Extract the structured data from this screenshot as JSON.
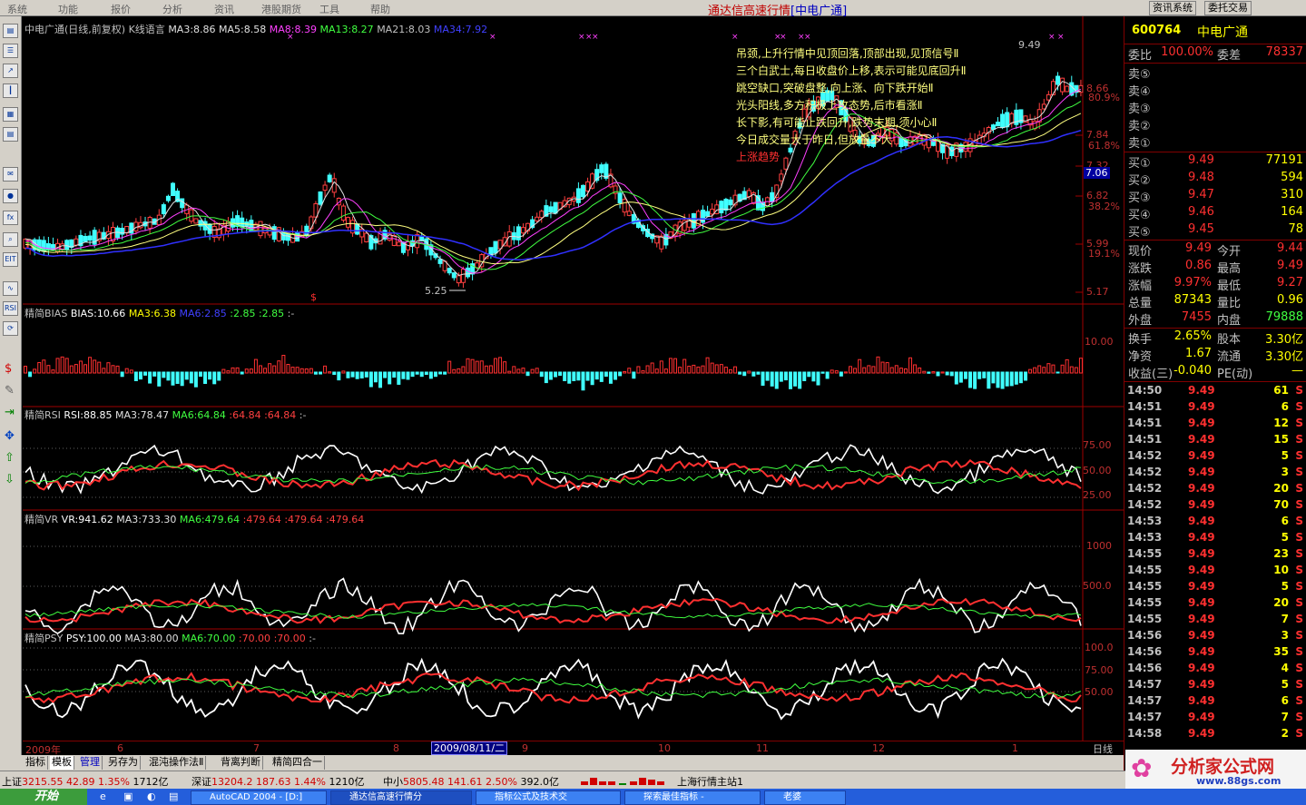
{
  "menu": [
    "系统",
    "功能",
    "报价",
    "分析",
    "资讯",
    "港股期货",
    "工具",
    "帮助"
  ],
  "app_title": "通达信高速行情",
  "app_title_sub": "[中电广通]",
  "top_buttons": [
    "资讯系统",
    "委托交易"
  ],
  "toolbar_icons": [
    "menu-icon",
    "list-icon",
    "chart-icon",
    "kline-icon",
    "news-icon",
    "table-icon",
    "mail-icon",
    "group-icon",
    "fx-icon",
    "search-icon",
    "eye-icon"
  ],
  "main_chart": {
    "title": "中电广通(日线,前复权)",
    "formula": "K线语言",
    "ma3": "MA3:8.86",
    "ma5": "MA5:8.58",
    "ma8": "MA8:8.39",
    "ma13": "MA13:8.27",
    "ma21": "MA21:8.03",
    "ma34": "MA34:7.92",
    "high_label": "9.49",
    "low_label": "5.25",
    "y_ticks": [
      "8.66",
      "7.84",
      "7.32",
      "6.82",
      "5.99",
      "5.17"
    ],
    "y_pct": [
      "80.9%",
      "61.8%",
      "38.2%",
      "19.1%"
    ],
    "cur_price": "7.06",
    "annotations": [
      "吊颈,上升行情中见顶回落,顶部出现,见顶信号Ⅱ",
      "三个白武士,每日收盘价上移,表示可能见底回升Ⅱ",
      "跳空缺口,突破盘整,向上涨、向下跌开始Ⅱ",
      "光头阳线,多方积极上攻态势,后市看涨Ⅱ",
      "长下影,有可能止跌回升,跌势末期,须小心Ⅱ",
      "今日成交量大于昨日,但放量不大"
    ],
    "trend_label": "上涨趋势"
  },
  "bias": {
    "name": "精简BIAS",
    "val": "BIAS:10.66",
    "ma3": "MA3:6.38",
    "ma6": "MA6:2.85",
    "v1": ":2.85",
    "v2": ":2.85",
    "v3": ":-",
    "tick": "10.00"
  },
  "rsi": {
    "name": "精简RSI",
    "val": "RSI:88.85",
    "ma3": "MA3:78.47",
    "ma6": "MA6:64.84",
    "v1": ":64.84",
    "v2": ":64.84",
    "v3": ":-",
    "ticks": [
      "75.00",
      "50.00",
      "25.00"
    ]
  },
  "vr": {
    "name": "精简VR",
    "val": "VR:941.62",
    "ma3": "MA3:733.30",
    "ma6": "MA6:479.64",
    "v1": ":479.64",
    "v2": ":479.64",
    "v3": ":479.64",
    "ticks": [
      "1000",
      "500.0"
    ]
  },
  "psy": {
    "name": "精简PSY",
    "val": "PSY:100.00",
    "ma3": "MA3:80.00",
    "ma6": "MA6:70.00",
    "v1": ":70.00",
    "v2": ":70.00",
    "v3": ":-",
    "ticks": [
      "100.0",
      "75.00",
      "50.00"
    ]
  },
  "time_axis": {
    "year": "2009年",
    "months": [
      "6",
      "7",
      "8",
      "9",
      "10",
      "11",
      "12",
      "1"
    ],
    "cursor_date": "2009/08/11/二",
    "period": "日线"
  },
  "tabs": [
    "指标",
    "模板",
    "管理",
    "另存为",
    "混沌操作法Ⅱ",
    "背离判断",
    "精简四合一"
  ],
  "status": {
    "sh_label": "上证",
    "sh_val": "3215.55",
    "sh_chg": "42.89",
    "sh_pct": "1.35%",
    "sh_amt": "1712亿",
    "sz_label": "深证",
    "sz_val": "13204.2",
    "sz_chg": "187.63",
    "sz_pct": "1.44%",
    "sz_amt": "1210亿",
    "zx_label": "中小",
    "zx_val": "5805.48",
    "zx_chg": "141.61",
    "zx_pct": "2.50%",
    "zx_amt": "392.0亿",
    "server": "上海行情主站1"
  },
  "taskbar": {
    "start": "开始",
    "tasks": [
      "AutoCAD 2004 - [D:]",
      "通达信高速行情分",
      "指标公式及技术交",
      "探索最佳指标 -",
      "老婆"
    ]
  },
  "quote": {
    "code": "600764",
    "name": "中电广通",
    "wb_label": "委比",
    "wb_val": "100.00%",
    "wc_label": "委差",
    "wc_val": "78337",
    "sells": [
      "卖⑤",
      "卖④",
      "卖③",
      "卖②",
      "卖①"
    ],
    "buys": [
      {
        "l": "买①",
        "p": "9.49",
        "v": "77191"
      },
      {
        "l": "买②",
        "p": "9.48",
        "v": "594"
      },
      {
        "l": "买③",
        "p": "9.47",
        "v": "310"
      },
      {
        "l": "买④",
        "p": "9.46",
        "v": "164"
      },
      {
        "l": "买⑤",
        "p": "9.45",
        "v": "78"
      }
    ],
    "stats": [
      {
        "l": "现价",
        "v": "9.49",
        "l2": "今开",
        "v2": "9.44"
      },
      {
        "l": "涨跌",
        "v": "0.86",
        "l2": "最高",
        "v2": "9.49"
      },
      {
        "l": "涨幅",
        "v": "9.97%",
        "l2": "最低",
        "v2": "9.27"
      },
      {
        "l": "总量",
        "v": "87343",
        "l2": "量比",
        "v2": "0.96"
      },
      {
        "l": "外盘",
        "v": "7455",
        "l2": "内盘",
        "v2": "79888"
      }
    ],
    "stats2": [
      {
        "l": "换手",
        "v": "2.65%",
        "l2": "股本",
        "v2": "3.30亿"
      },
      {
        "l": "净资",
        "v": "1.67",
        "l2": "流通",
        "v2": "3.30亿"
      },
      {
        "l": "收益(三)",
        "v": "-0.040",
        "l2": "PE(动)",
        "v2": "—"
      }
    ],
    "ticks": [
      {
        "t": "14:50",
        "p": "9.49",
        "q": "61",
        "s": "S"
      },
      {
        "t": "14:51",
        "p": "9.49",
        "q": "6",
        "s": "S"
      },
      {
        "t": "14:51",
        "p": "9.49",
        "q": "12",
        "s": "S"
      },
      {
        "t": "14:51",
        "p": "9.49",
        "q": "15",
        "s": "S"
      },
      {
        "t": "14:52",
        "p": "9.49",
        "q": "5",
        "s": "S"
      },
      {
        "t": "14:52",
        "p": "9.49",
        "q": "3",
        "s": "S"
      },
      {
        "t": "14:52",
        "p": "9.49",
        "q": "20",
        "s": "S"
      },
      {
        "t": "14:52",
        "p": "9.49",
        "q": "70",
        "s": "S"
      },
      {
        "t": "14:53",
        "p": "9.49",
        "q": "6",
        "s": "S"
      },
      {
        "t": "14:53",
        "p": "9.49",
        "q": "5",
        "s": "S"
      },
      {
        "t": "14:55",
        "p": "9.49",
        "q": "23",
        "s": "S"
      },
      {
        "t": "14:55",
        "p": "9.49",
        "q": "10",
        "s": "S"
      },
      {
        "t": "14:55",
        "p": "9.49",
        "q": "5",
        "s": "S"
      },
      {
        "t": "14:55",
        "p": "9.49",
        "q": "20",
        "s": "S"
      },
      {
        "t": "14:55",
        "p": "9.49",
        "q": "7",
        "s": "S"
      },
      {
        "t": "14:56",
        "p": "9.49",
        "q": "3",
        "s": "S"
      },
      {
        "t": "14:56",
        "p": "9.49",
        "q": "35",
        "s": "S"
      },
      {
        "t": "14:56",
        "p": "9.49",
        "q": "4",
        "s": "S"
      },
      {
        "t": "14:57",
        "p": "9.49",
        "q": "5",
        "s": "S"
      },
      {
        "t": "14:57",
        "p": "9.49",
        "q": "6",
        "s": "S"
      },
      {
        "t": "14:57",
        "p": "9.49",
        "q": "7",
        "s": "S"
      },
      {
        "t": "14:58",
        "p": "9.49",
        "q": "2",
        "s": "S"
      }
    ]
  },
  "watermark": {
    "text": "分析家公式网",
    "url": "www.88gs.com"
  }
}
